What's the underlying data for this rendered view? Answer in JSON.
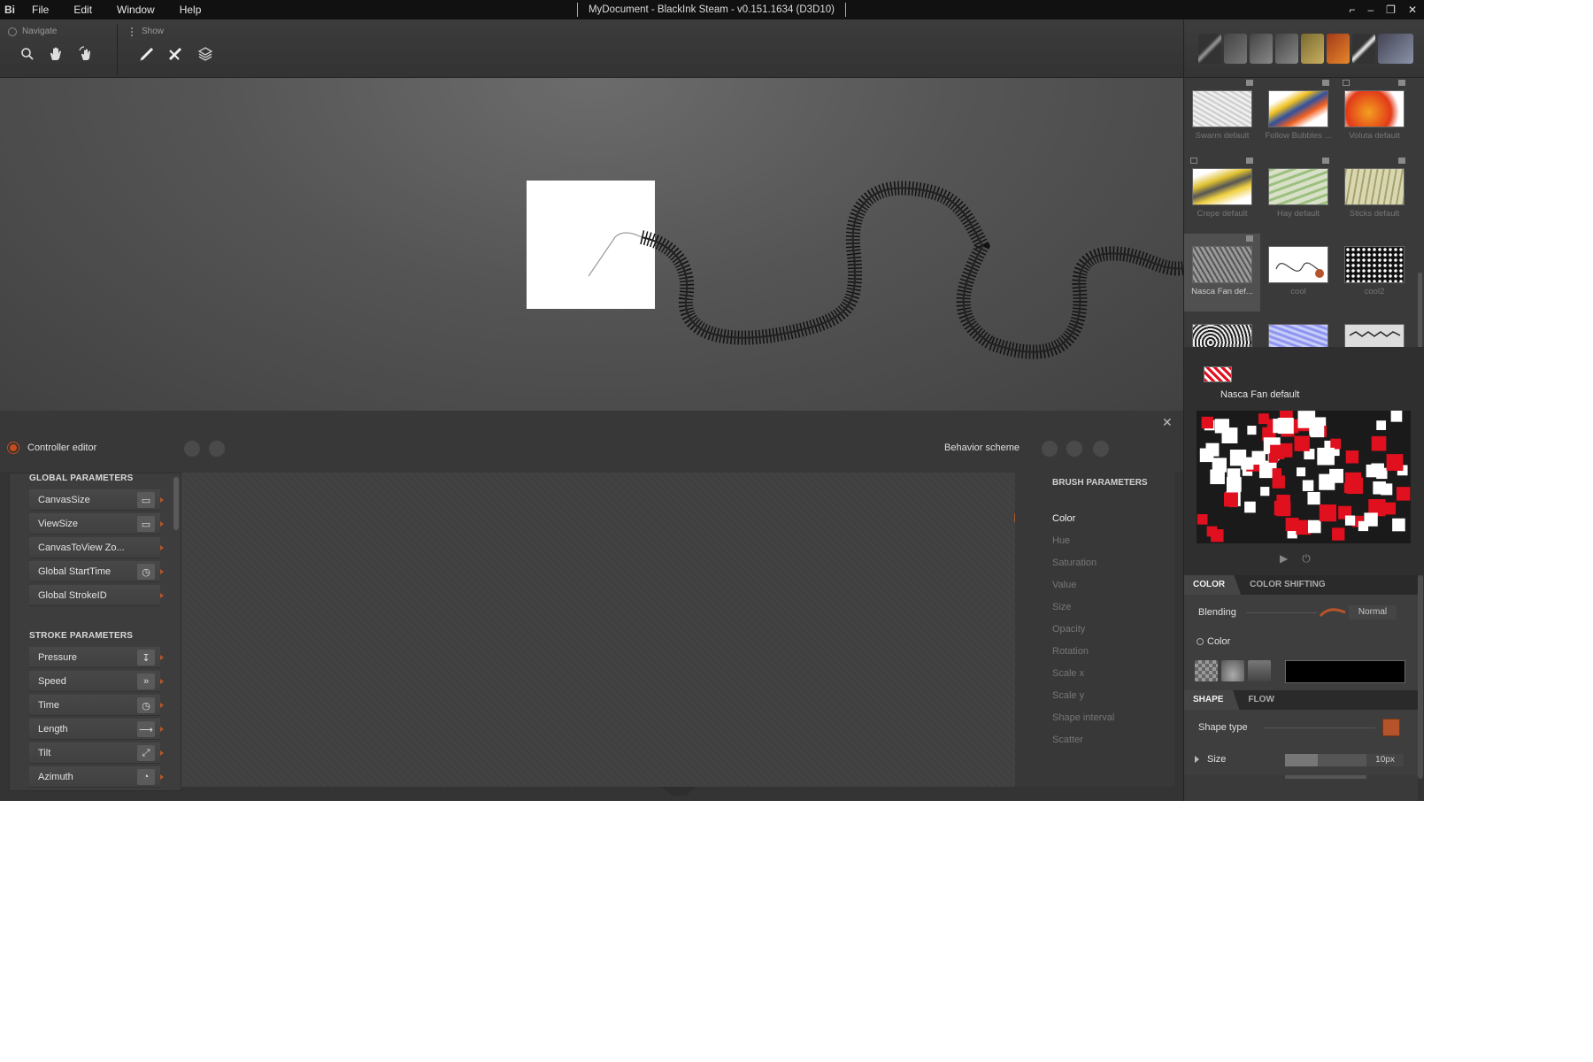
{
  "menubar": {
    "logo": "Bi",
    "items": [
      "File",
      "Edit",
      "Window",
      "Help"
    ],
    "title": "MyDocument - BlackInk Steam - v0.151.1634 (D3D10)",
    "controls": [
      "⌐",
      "–",
      "❐",
      "✕"
    ]
  },
  "toolbar": {
    "navigate_label": "Navigate",
    "show_label": "Show"
  },
  "controller": {
    "title": "Controller editor",
    "behavior_label": "Behavior scheme",
    "close": "✕",
    "global_section": "GLOBAL PARAMETERS",
    "global_params": [
      "CanvasSize",
      "ViewSize",
      "CanvasToView Zo...",
      "Global StartTime",
      "Global StrokeID"
    ],
    "stroke_section": "STROKE PARAMETERS",
    "stroke_params": [
      "Pressure",
      "Speed",
      "Time",
      "Length",
      "Tilt",
      "Azimuth"
    ],
    "brush_section": "BRUSH PARAMETERS",
    "brush_params": [
      "Color",
      "Hue",
      "Saturation",
      "Value",
      "Size",
      "Opacity",
      "Rotation",
      "Scale x",
      "Scale y",
      "Shape interval",
      "Scatter"
    ]
  },
  "brushes": {
    "items": [
      {
        "name": "Swarm default"
      },
      {
        "name": "Follow Bubbles ..."
      },
      {
        "name": "Voluta default"
      },
      {
        "name": "Crepe default"
      },
      {
        "name": "Hay default"
      },
      {
        "name": "Sticks default"
      },
      {
        "name": "Nasca Fan def...",
        "selected": true
      },
      {
        "name": "cool"
      },
      {
        "name": "cool2"
      },
      {
        "name": ""
      },
      {
        "name": ""
      },
      {
        "name": ""
      }
    ]
  },
  "preview": {
    "name": "Nasca Fan default",
    "play": "▶",
    "power": "⏻"
  },
  "properties": {
    "color_tab": "COLOR",
    "color_shifting_tab": "COLOR SHIFTING",
    "blending_label": "Blending",
    "blending_value": "Normal",
    "color_label": "Color",
    "color_value": "#000000",
    "shape_tab": "SHAPE",
    "flow_tab": "FLOW",
    "shape_type_label": "Shape type",
    "size_label": "Size",
    "size_value": "10px",
    "size_fraction": 0.4
  },
  "colors": {
    "accent": "#b5542a",
    "preview_red": "#e0101e"
  }
}
